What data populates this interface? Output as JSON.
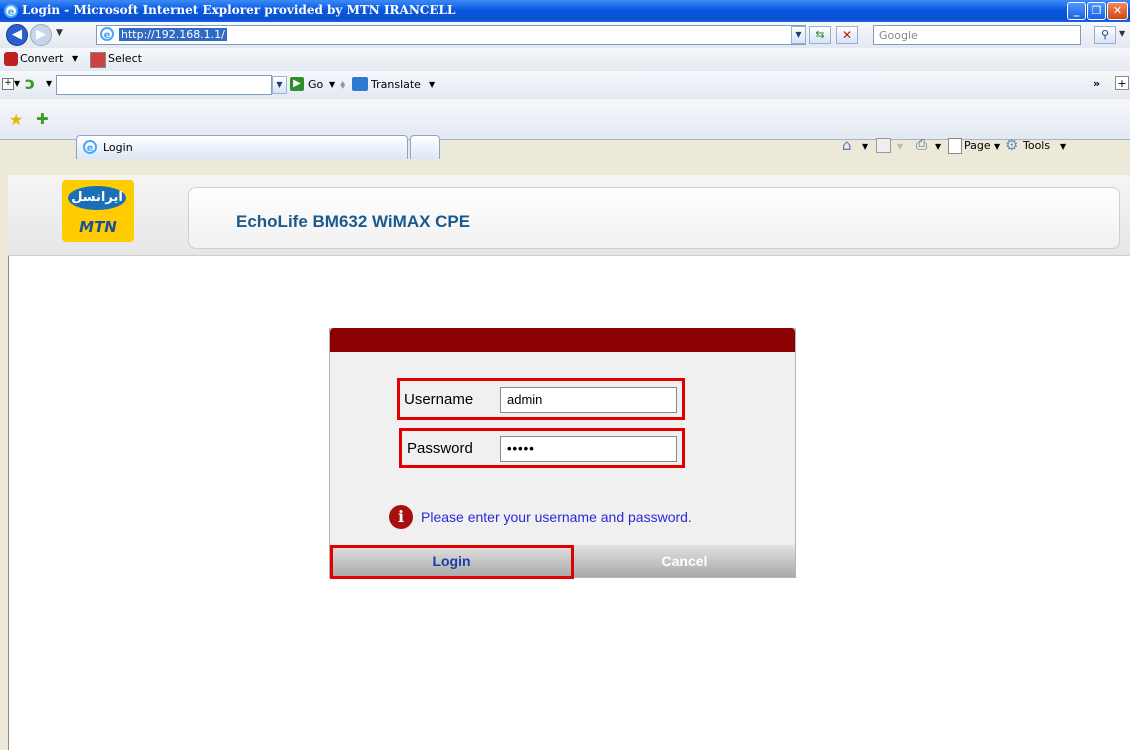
{
  "window": {
    "title": "Login - Microsoft Internet Explorer provided by MTN IRANCELL",
    "minimize_icon": "_",
    "restore_icon": "❐",
    "close_icon": "✕"
  },
  "address_bar": {
    "url": "http://192.168.1.1/",
    "search_placeholder": "Google"
  },
  "toolbar1": {
    "convert_label": "Convert",
    "select_label": "Select"
  },
  "toolbar2": {
    "go_label": "Go",
    "translate_label": "Translate",
    "overflow_label": "»"
  },
  "tabs": {
    "active_label": "Login"
  },
  "command_bar": {
    "page_label": "Page",
    "tools_label": "Tools"
  },
  "header": {
    "logo_text": "ایرانسل",
    "logo_brand": "MTN",
    "device_name": "EchoLife BM632 WiMAX CPE"
  },
  "login": {
    "username_label": "Username",
    "username_value": "admin",
    "password_label": "Password",
    "password_value": "•••••",
    "message": "Please enter your username and password.",
    "login_button": "Login",
    "cancel_button": "Cancel"
  },
  "colors": {
    "login_header": "#8b0000",
    "highlight": "#e00000",
    "message_text": "#2a2ad8",
    "device_title": "#1a5a8e",
    "logo_yellow": "#ffcc00"
  }
}
